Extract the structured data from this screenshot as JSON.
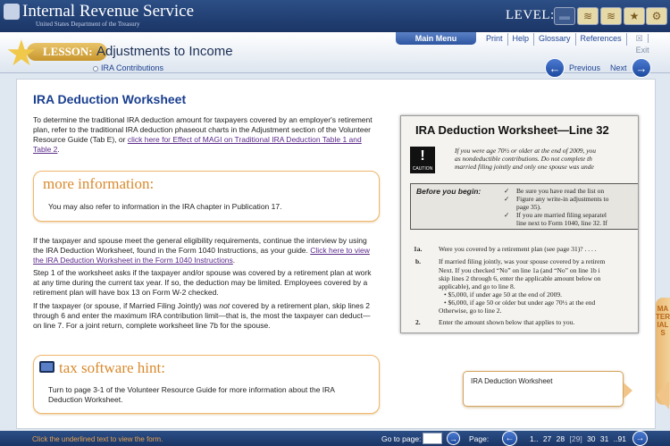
{
  "header": {
    "org_name": "Internal Revenue Service",
    "org_subtitle": "United States Department of the Treasury",
    "level_label": "LEVEL:",
    "level_icons": [
      "level-1-icon",
      "level-2-icon",
      "level-3-icon",
      "level-4-icon",
      "level-5-icon"
    ]
  },
  "lesson": {
    "tag": "LESSON:",
    "title": "Adjustments to Income",
    "breadcrumb": "IRA Contributions"
  },
  "nav": {
    "main_menu": "Main Menu",
    "links": [
      "Print",
      "Help",
      "Glossary",
      "References",
      "Exit"
    ],
    "previous": "Previous",
    "next": "Next"
  },
  "main": {
    "title": "IRA Deduction Worksheet",
    "para1_text": "To determine the traditional IRA deduction amount for taxpayers covered by an employer's retirement plan, refer to the traditional IRA deduction phaseout charts in the Adjustment section of the Volunteer Resource Guide (Tab E), or ",
    "para1_link": "click here for Effect of MAGI on Traditional IRA Deduction Table 1 and Table 2",
    "para1_end": ".",
    "more_info_head": "more information:",
    "more_info_text": "You may also refer to information in the IRA chapter in Publication 17.",
    "para2_text": "If the taxpayer and spouse meet the general eligibility requirements, continue the interview by using the IRA Deduction Worksheet, found in the Form 1040 Instructions, as your guide. ",
    "para2_link": "Click here to view the IRA Deduction Worksheet in the Form 1040 Instructions",
    "para2_end": ".",
    "para3": "Step 1 of the worksheet asks if the taxpayer and/or spouse was covered by a retirement plan at work at any time during the current tax year. If so, the deduction may be limited. Employees covered by a retirement plan will have box 13 on Form W-2 checked.",
    "para4_a": "If the taxpayer (or spouse, if Married Filing Jointly) was ",
    "para4_em": "not",
    "para4_b": " covered by a retirement plan, skip lines 2 through 6 and enter the maximum IRA contribution limit—that is, the most the taxpayer can deduct—on line 7. For a joint return, complete worksheet line 7b for the spouse.",
    "hint_head": "tax software hint:",
    "hint_text": "Turn to page 3-1 of the Volunteer Resource Guide for more information about the IRA Deduction Worksheet."
  },
  "form_image": {
    "title": "IRA Deduction Worksheet—Line 32",
    "caution": "CAUTION",
    "intro1": "If you were age 70½ or older at the end of 2009, you",
    "intro2": "as nondeductible contributions. Do not complete th",
    "intro3": "married filing jointly and only one spouse was unde",
    "before_label": "Before you begin:",
    "before1": "Be sure you have read the list on",
    "before2": "Figure any write-in adjustments to",
    "before3": "page 35).",
    "before4": "If you are married filing separatel",
    "before5": "line next to Form 1040, line 32. If",
    "line1a_num": "1a.",
    "line1a": "Were you covered by a retirement plan (see page 31)? . . . .",
    "line1b_num": "b.",
    "line1b": "If married filing jointly, was your spouse covered by a retirem",
    "next1": "Next. If you checked “No” on line 1a (and “No” on line 1b i",
    "next2": "skip lines 2 through 6, enter the applicable amount below on",
    "next3": "applicable), and go to line 8.",
    "bullet1": "• $5,000, if under age 50 at the end of 2009.",
    "bullet2": "• $6,000, if age 50 or older but under age 70½ at the end",
    "otherwise": "Otherwise, go to line 2.",
    "line2_num": "2.",
    "line2": "Enter the amount shown below that applies to you."
  },
  "caption": "IRA Deduction Worksheet",
  "materials_tab": "MATERIALS",
  "footer": {
    "hint": "Click the underlined text to view the form.",
    "goto_label": "Go to page:",
    "goto_value": "",
    "page_label": "Page:",
    "pages": [
      "1..",
      "27",
      "28",
      "[29]",
      "30",
      "31",
      "..91"
    ]
  },
  "colors": {
    "header_bg": "#1b3566",
    "accent_orange": "#d98a2d",
    "link_purple": "#5a2a8a",
    "title_blue": "#1a3f8f"
  }
}
